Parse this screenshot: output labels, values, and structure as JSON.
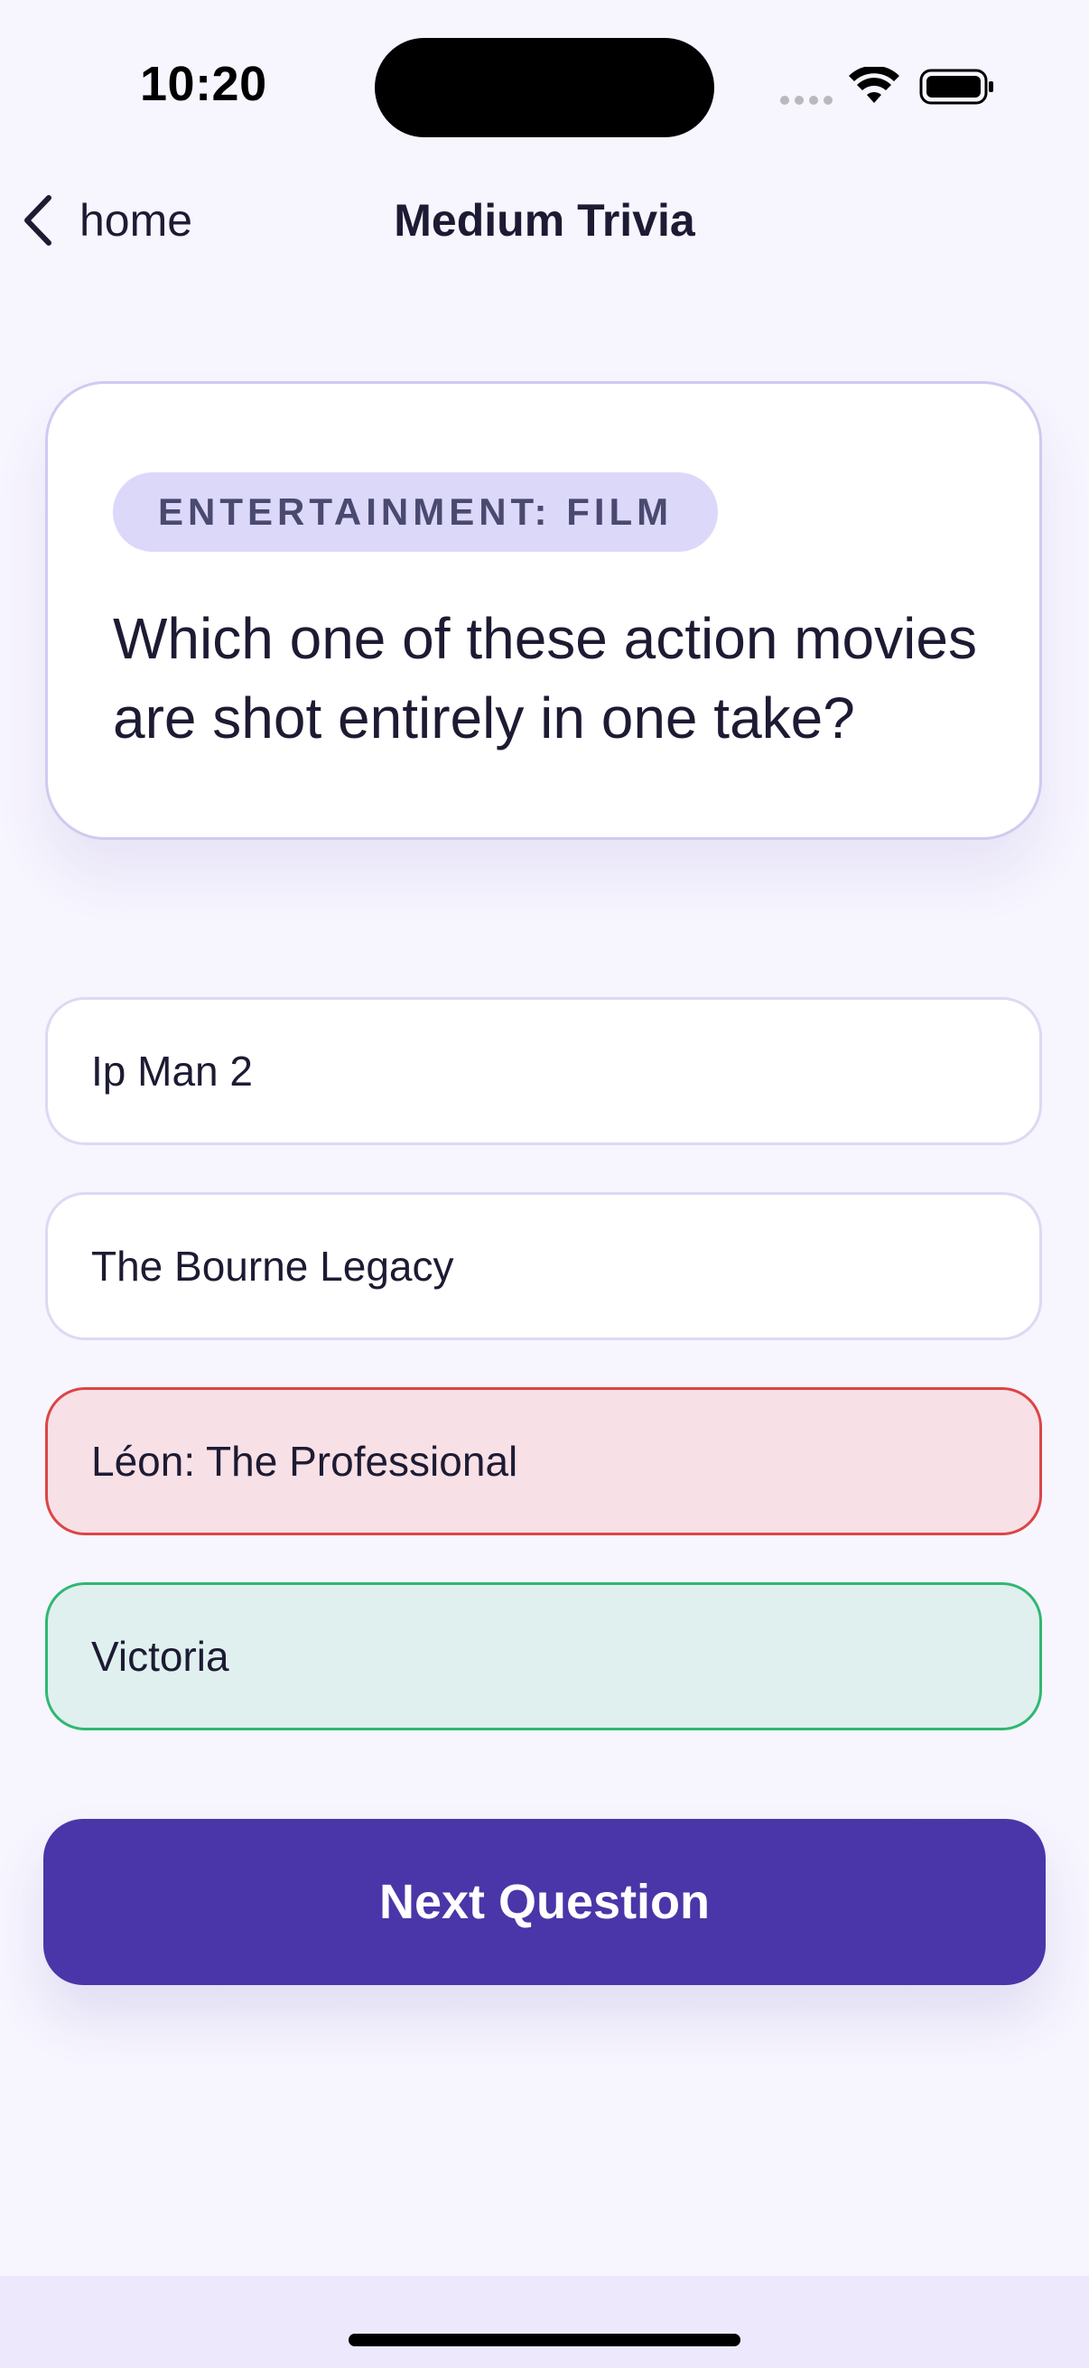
{
  "status_bar": {
    "time": "10:20",
    "icons": [
      "signal-dots-icon",
      "wifi-icon",
      "battery-icon"
    ]
  },
  "nav": {
    "back_label": "home",
    "title": "Medium Trivia"
  },
  "question": {
    "category": "ENTERTAINMENT: FILM",
    "text": "Which one of these action movies are shot entirely in one take?"
  },
  "answers": [
    {
      "label": "Ip Man 2",
      "state": "neutral"
    },
    {
      "label": "The Bourne Legacy",
      "state": "neutral"
    },
    {
      "label": "Léon: The Professional",
      "state": "wrong"
    },
    {
      "label": "Victoria",
      "state": "correct"
    }
  ],
  "next_button": {
    "label": "Next Question"
  },
  "colors": {
    "background": "#f7f5fe",
    "accent": "#4a36a8",
    "badge": "#dcd8fa",
    "wrong_bg": "#f7e0e6",
    "wrong_border": "#dc4545",
    "correct_bg": "#e0f0ef",
    "correct_border": "#2fb872"
  }
}
